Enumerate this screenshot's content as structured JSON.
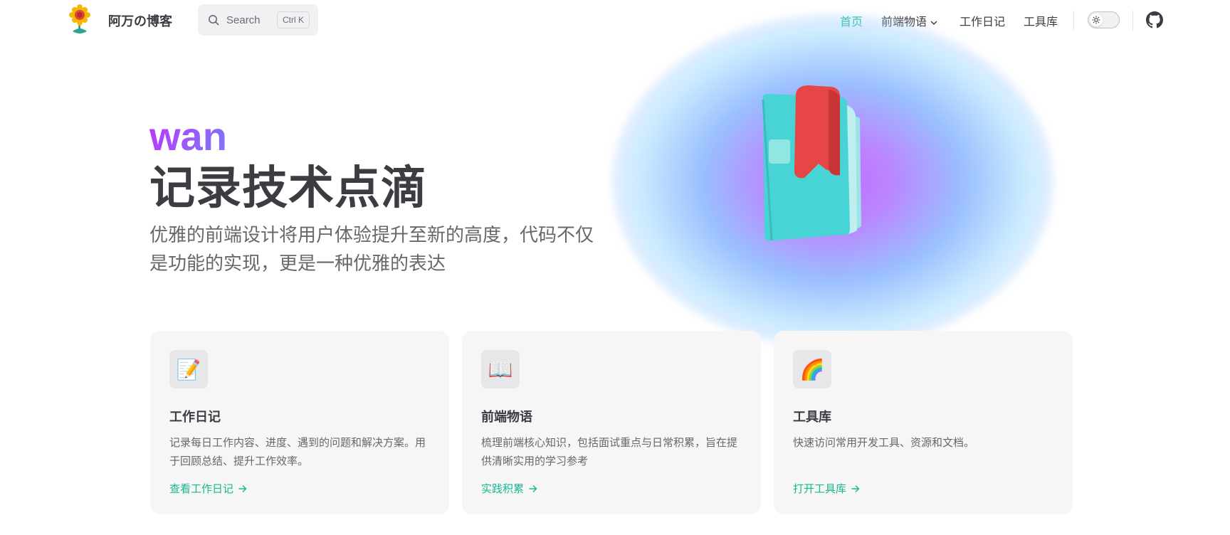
{
  "site": {
    "title": "阿万の博客",
    "logo_icon": "sunflower-icon"
  },
  "search": {
    "label": "Search",
    "shortcut": "Ctrl K",
    "icon": "search-icon"
  },
  "nav": {
    "items": [
      {
        "label": "首页",
        "active": true
      },
      {
        "label": "前端物语",
        "has_dropdown": true
      },
      {
        "label": "工作日记"
      },
      {
        "label": "工具库"
      }
    ],
    "theme_toggle_icon": "sun-icon",
    "github_icon": "github-icon"
  },
  "hero": {
    "name": "wan",
    "text": "记录技术点滴",
    "tagline_line1": "优雅的前端设计将用户体验提升至新的高度，代码不仅",
    "tagline_line2": "是功能的实现，更是一种优雅的表达",
    "image": "notebook-illustration"
  },
  "features": [
    {
      "icon": "📝",
      "icon_name": "memo-icon",
      "title": "工作日记",
      "details": "记录每日工作内容、进度、遇到的问题和解决方案。用于回顾总结、提升工作效率。",
      "link": "查看工作日记"
    },
    {
      "icon": "📖",
      "icon_name": "open-book-icon",
      "title": "前端物语",
      "details": "梳理前端核心知识，包括面试重点与日常积累，旨在提供清晰实用的学习参考",
      "link": "实践积累"
    },
    {
      "icon": "🌈",
      "icon_name": "rainbow-icon",
      "title": "工具库",
      "details": "快速访问常用开发工具、资源和文档。",
      "link": "打开工具库"
    }
  ],
  "colors": {
    "brand": "#17b991",
    "text": "#3c3c43",
    "muted": "#67676c",
    "card_bg": "#f6f6f7"
  }
}
